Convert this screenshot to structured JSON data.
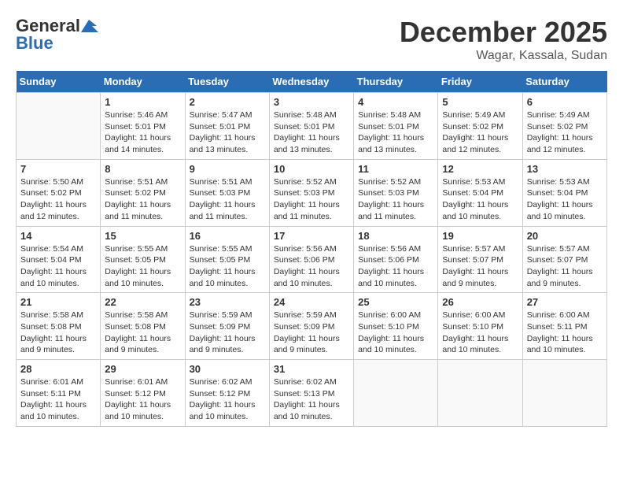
{
  "header": {
    "logo_general": "General",
    "logo_blue": "Blue",
    "title": "December 2025",
    "subtitle": "Wagar, Kassala, Sudan"
  },
  "weekdays": [
    "Sunday",
    "Monday",
    "Tuesday",
    "Wednesday",
    "Thursday",
    "Friday",
    "Saturday"
  ],
  "weeks": [
    [
      {
        "day": "",
        "info": ""
      },
      {
        "day": "1",
        "info": "Sunrise: 5:46 AM\nSunset: 5:01 PM\nDaylight: 11 hours\nand 14 minutes."
      },
      {
        "day": "2",
        "info": "Sunrise: 5:47 AM\nSunset: 5:01 PM\nDaylight: 11 hours\nand 13 minutes."
      },
      {
        "day": "3",
        "info": "Sunrise: 5:48 AM\nSunset: 5:01 PM\nDaylight: 11 hours\nand 13 minutes."
      },
      {
        "day": "4",
        "info": "Sunrise: 5:48 AM\nSunset: 5:01 PM\nDaylight: 11 hours\nand 13 minutes."
      },
      {
        "day": "5",
        "info": "Sunrise: 5:49 AM\nSunset: 5:02 PM\nDaylight: 11 hours\nand 12 minutes."
      },
      {
        "day": "6",
        "info": "Sunrise: 5:49 AM\nSunset: 5:02 PM\nDaylight: 11 hours\nand 12 minutes."
      }
    ],
    [
      {
        "day": "7",
        "info": "Sunrise: 5:50 AM\nSunset: 5:02 PM\nDaylight: 11 hours\nand 12 minutes."
      },
      {
        "day": "8",
        "info": "Sunrise: 5:51 AM\nSunset: 5:02 PM\nDaylight: 11 hours\nand 11 minutes."
      },
      {
        "day": "9",
        "info": "Sunrise: 5:51 AM\nSunset: 5:03 PM\nDaylight: 11 hours\nand 11 minutes."
      },
      {
        "day": "10",
        "info": "Sunrise: 5:52 AM\nSunset: 5:03 PM\nDaylight: 11 hours\nand 11 minutes."
      },
      {
        "day": "11",
        "info": "Sunrise: 5:52 AM\nSunset: 5:03 PM\nDaylight: 11 hours\nand 11 minutes."
      },
      {
        "day": "12",
        "info": "Sunrise: 5:53 AM\nSunset: 5:04 PM\nDaylight: 11 hours\nand 10 minutes."
      },
      {
        "day": "13",
        "info": "Sunrise: 5:53 AM\nSunset: 5:04 PM\nDaylight: 11 hours\nand 10 minutes."
      }
    ],
    [
      {
        "day": "14",
        "info": "Sunrise: 5:54 AM\nSunset: 5:04 PM\nDaylight: 11 hours\nand 10 minutes."
      },
      {
        "day": "15",
        "info": "Sunrise: 5:55 AM\nSunset: 5:05 PM\nDaylight: 11 hours\nand 10 minutes."
      },
      {
        "day": "16",
        "info": "Sunrise: 5:55 AM\nSunset: 5:05 PM\nDaylight: 11 hours\nand 10 minutes."
      },
      {
        "day": "17",
        "info": "Sunrise: 5:56 AM\nSunset: 5:06 PM\nDaylight: 11 hours\nand 10 minutes."
      },
      {
        "day": "18",
        "info": "Sunrise: 5:56 AM\nSunset: 5:06 PM\nDaylight: 11 hours\nand 10 minutes."
      },
      {
        "day": "19",
        "info": "Sunrise: 5:57 AM\nSunset: 5:07 PM\nDaylight: 11 hours\nand 9 minutes."
      },
      {
        "day": "20",
        "info": "Sunrise: 5:57 AM\nSunset: 5:07 PM\nDaylight: 11 hours\nand 9 minutes."
      }
    ],
    [
      {
        "day": "21",
        "info": "Sunrise: 5:58 AM\nSunset: 5:08 PM\nDaylight: 11 hours\nand 9 minutes."
      },
      {
        "day": "22",
        "info": "Sunrise: 5:58 AM\nSunset: 5:08 PM\nDaylight: 11 hours\nand 9 minutes."
      },
      {
        "day": "23",
        "info": "Sunrise: 5:59 AM\nSunset: 5:09 PM\nDaylight: 11 hours\nand 9 minutes."
      },
      {
        "day": "24",
        "info": "Sunrise: 5:59 AM\nSunset: 5:09 PM\nDaylight: 11 hours\nand 9 minutes."
      },
      {
        "day": "25",
        "info": "Sunrise: 6:00 AM\nSunset: 5:10 PM\nDaylight: 11 hours\nand 10 minutes."
      },
      {
        "day": "26",
        "info": "Sunrise: 6:00 AM\nSunset: 5:10 PM\nDaylight: 11 hours\nand 10 minutes."
      },
      {
        "day": "27",
        "info": "Sunrise: 6:00 AM\nSunset: 5:11 PM\nDaylight: 11 hours\nand 10 minutes."
      }
    ],
    [
      {
        "day": "28",
        "info": "Sunrise: 6:01 AM\nSunset: 5:11 PM\nDaylight: 11 hours\nand 10 minutes."
      },
      {
        "day": "29",
        "info": "Sunrise: 6:01 AM\nSunset: 5:12 PM\nDaylight: 11 hours\nand 10 minutes."
      },
      {
        "day": "30",
        "info": "Sunrise: 6:02 AM\nSunset: 5:12 PM\nDaylight: 11 hours\nand 10 minutes."
      },
      {
        "day": "31",
        "info": "Sunrise: 6:02 AM\nSunset: 5:13 PM\nDaylight: 11 hours\nand 10 minutes."
      },
      {
        "day": "",
        "info": ""
      },
      {
        "day": "",
        "info": ""
      },
      {
        "day": "",
        "info": ""
      }
    ]
  ]
}
